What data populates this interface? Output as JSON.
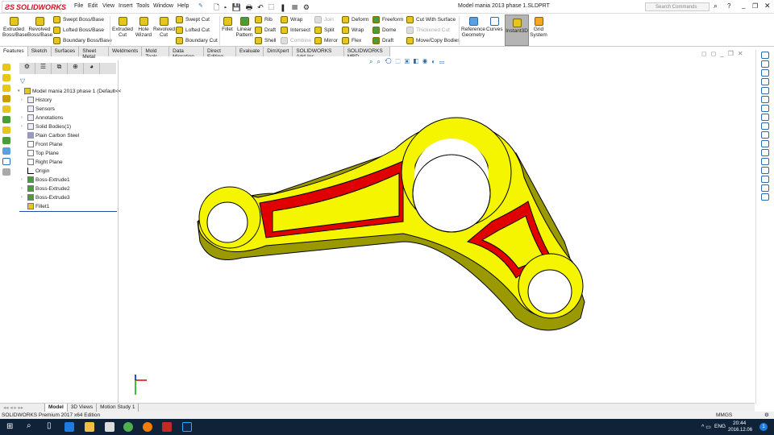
{
  "app": {
    "logo": "SOLIDWORKS",
    "title": "Model mania 2013 phase 1.SLDPRT",
    "search_placeholder": "Search Commands"
  },
  "menu": [
    "File",
    "Edit",
    "View",
    "Insert",
    "Tools",
    "Window",
    "Help"
  ],
  "ribbon": {
    "big": [
      "Extruded Boss/Base",
      "Revolved Boss/Base",
      "Extruded Cut",
      "Hole Wizard",
      "Revolved Cut",
      "Fillet",
      "Linear Pattern",
      "Reference Geometry",
      "Curves",
      "Instant3D",
      "Grid System"
    ],
    "small": [
      "Swept Boss/Base",
      "Lofted Boss/Base",
      "Boundary Boss/Base",
      "Swept Cut",
      "Lofted Cut",
      "Boundary Cut",
      "Rib",
      "Draft",
      "Shell",
      "Wrap",
      "Intersect",
      "Combine",
      "Join",
      "Split",
      "Mirror",
      "Deform",
      "Wrap",
      "Flex",
      "Freeform",
      "Dome",
      "Draft",
      "Cut With Surface",
      "Thickened Cut",
      "Move/Copy Bodies"
    ]
  },
  "tabs": [
    "Features",
    "Sketch",
    "Surfaces",
    "Sheet Metal",
    "Weldments",
    "Mold Tools",
    "Data Migration",
    "Direct Editing",
    "Evaluate",
    "DimXpert",
    "SOLIDWORKS Add-Ins",
    "SOLIDWORKS MBD"
  ],
  "tree": [
    "Model mania 2013 phase 1  (Default<<De",
    "History",
    "Sensors",
    "Annotations",
    "Solid Bodies(1)",
    "Plain Carbon Steel",
    "Front Plane",
    "Top Plane",
    "Right Plane",
    "Origin",
    "Boss-Extrude1",
    "Boss-Extrude2",
    "Boss-Extrude3",
    "Fillet1"
  ],
  "bottom_tabs": [
    "Model",
    "3D Views",
    "Motion Study 1"
  ],
  "status": {
    "edition": "SOLIDWORKS Premium 2017 x64 Edition",
    "units": "MMGS"
  },
  "taskbar": {
    "lang": "ENG",
    "time": "20:44",
    "date": "2016.12.06",
    "notifications": "1"
  },
  "colors": {
    "part": "#f5f500",
    "pocket": "#e00000",
    "accent": "#d0101e"
  }
}
